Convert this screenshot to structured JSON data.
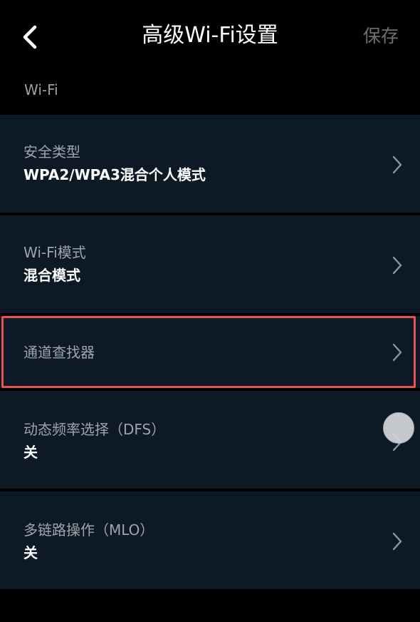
{
  "header": {
    "title": "高级Wi-Fi设置",
    "save_label": "保存",
    "back_icon": "chevron-left-icon"
  },
  "section": {
    "label": "Wi-Fi"
  },
  "rows": [
    {
      "label": "安全类型",
      "value": "WPA2/WPA3混合个人模式"
    },
    {
      "label": "Wi-Fi模式",
      "value": "混合模式"
    },
    {
      "label": "通道查找器",
      "value": ""
    },
    {
      "label": "动态频率选择（DFS）",
      "value": "关"
    },
    {
      "label": "多链路操作（MLO）",
      "value": "关"
    }
  ],
  "colors": {
    "background": "#000000",
    "row_background": "#0d1a26",
    "highlight_border": "#e8524f",
    "secondary_text": "#9ea4ab",
    "disabled_text": "#6d6f73"
  }
}
